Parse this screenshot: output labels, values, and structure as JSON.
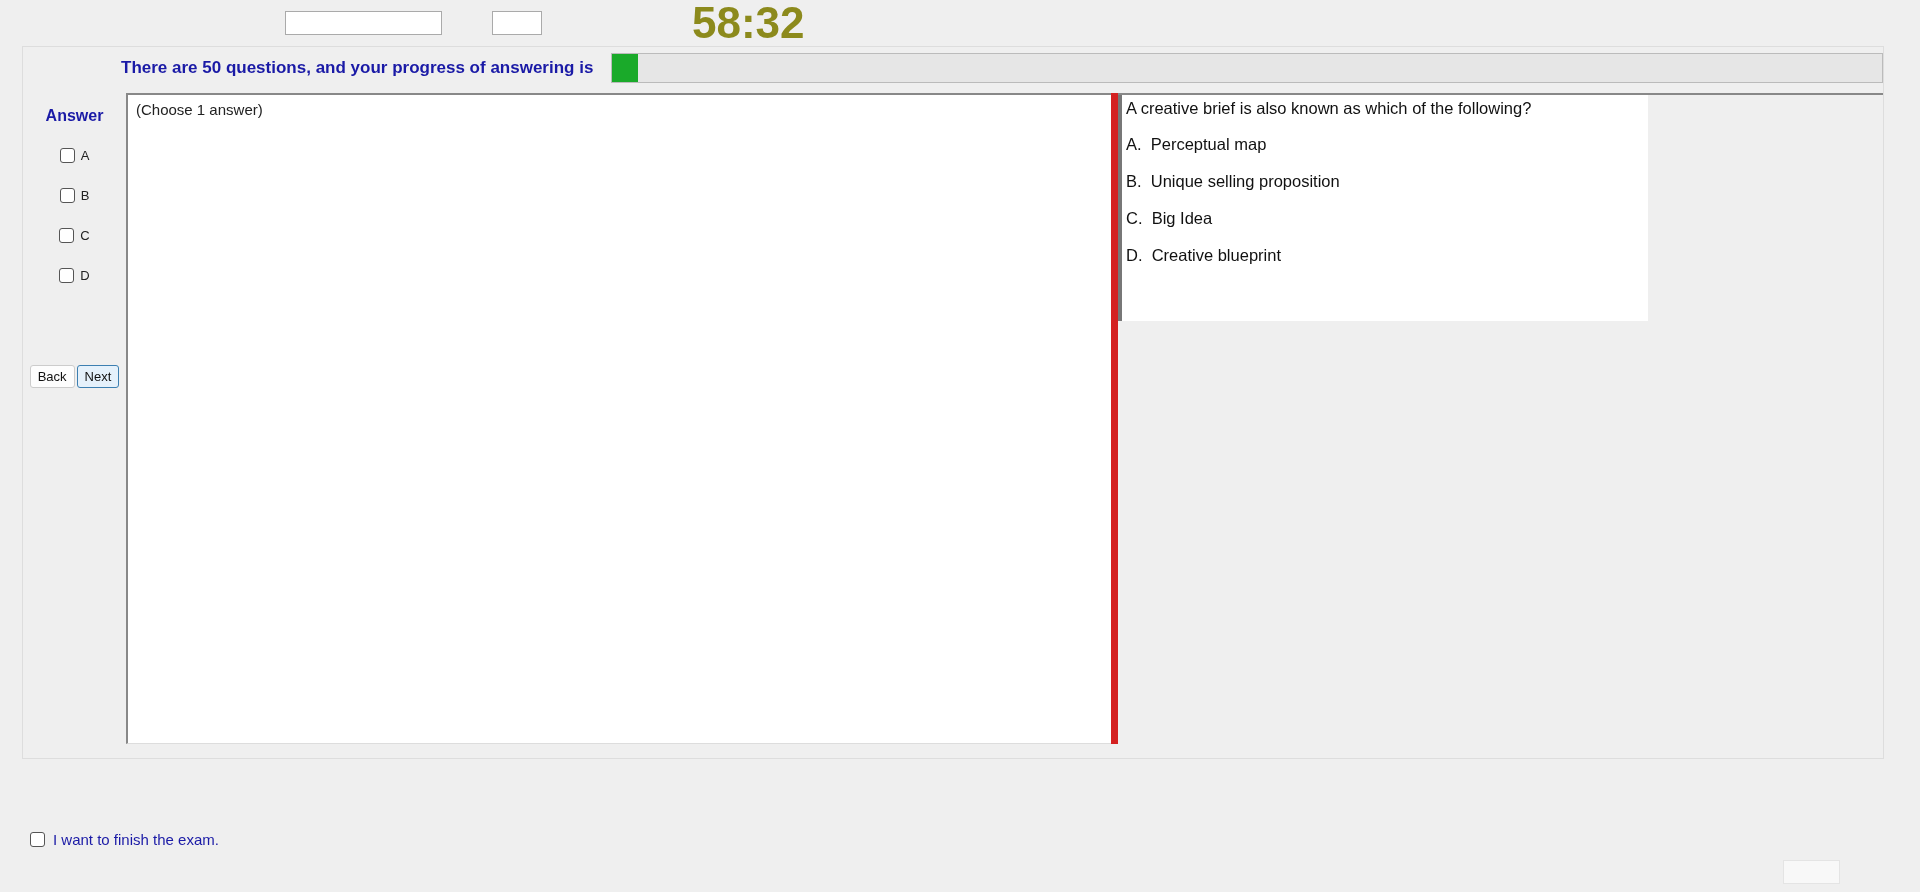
{
  "timer": "58:32",
  "progress": {
    "label": "There are 50 questions, and your progress of answering is",
    "level": 0.02
  },
  "answer_panel": {
    "title": "Answer",
    "options": [
      {
        "label": "A",
        "checked": false
      },
      {
        "label": "B",
        "checked": false
      },
      {
        "label": "C",
        "checked": false
      },
      {
        "label": "D",
        "checked": false
      }
    ]
  },
  "buttons": [
    {
      "label": "Back",
      "selected": false
    },
    {
      "label": "Next",
      "selected": true
    }
  ],
  "answer_box": {
    "text": "(Choose 1 answer)"
  },
  "question": {
    "text": "A creative brief is also known as which of the following?",
    "choices": [
      "A.  Perceptual map",
      "B.  Unique selling proposition",
      "C.  Big Idea",
      "D.  Creative blueprint"
    ]
  },
  "finish": {
    "label": "I want to finish the exam.",
    "checked": false
  }
}
